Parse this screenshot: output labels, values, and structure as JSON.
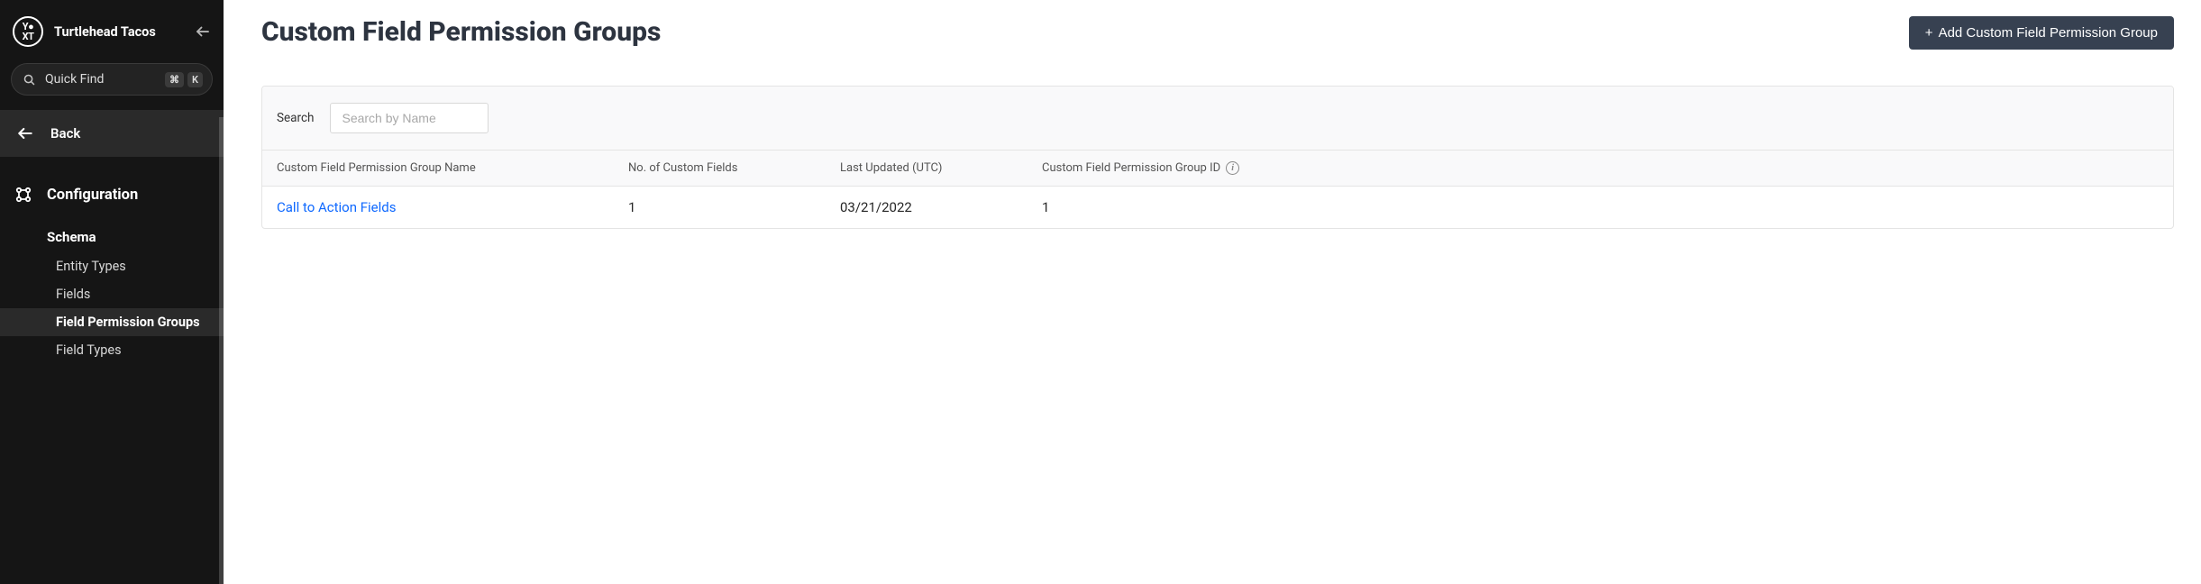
{
  "sidebar": {
    "brand_name": "Turtlehead Tacos",
    "quickfind_label": "Quick Find",
    "kbd_cmd": "⌘",
    "kbd_k": "K",
    "back_label": "Back",
    "section_title": "Configuration",
    "subsection_title": "Schema",
    "nav": {
      "entity_types": "Entity Types",
      "fields": "Fields",
      "field_permission_groups": "Field Permission Groups",
      "field_types": "Field Types"
    }
  },
  "header": {
    "page_title": "Custom Field Permission Groups",
    "add_button": "Add Custom Field Permission Group",
    "add_plus": "+"
  },
  "search": {
    "label": "Search",
    "placeholder": "Search by Name"
  },
  "table": {
    "columns": {
      "name": "Custom Field Permission Group Name",
      "count": "No. of Custom Fields",
      "updated": "Last Updated (UTC)",
      "id": "Custom Field Permission Group ID"
    },
    "rows": [
      {
        "name": "Call to Action Fields",
        "count": "1",
        "updated": "03/21/2022",
        "id": "1"
      }
    ]
  }
}
